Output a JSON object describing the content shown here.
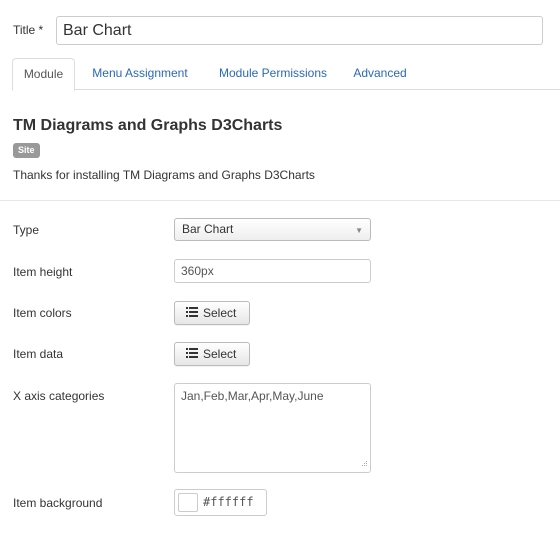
{
  "title_field": {
    "label": "Title *",
    "value": "Bar Chart"
  },
  "tabs": [
    {
      "label": "Module",
      "active": true
    },
    {
      "label": "Menu Assignment",
      "active": false
    },
    {
      "label": "Module Permissions",
      "active": false
    },
    {
      "label": "Advanced",
      "active": false
    }
  ],
  "module": {
    "name": "TM Diagrams and Graphs D3Charts",
    "badge": "Site",
    "description": "Thanks for installing TM Diagrams and Graphs D3Charts"
  },
  "form": {
    "type": {
      "label": "Type",
      "value": "Bar Chart"
    },
    "item_height": {
      "label": "Item height",
      "value": "360px"
    },
    "item_colors": {
      "label": "Item colors",
      "button": "Select"
    },
    "item_data": {
      "label": "Item data",
      "button": "Select"
    },
    "x_axis": {
      "label": "X axis categories",
      "value": "Jan,Feb,Mar,Apr,May,June"
    },
    "item_background": {
      "label": "Item background",
      "value": "#ffffff"
    }
  },
  "colors": {
    "link": "#2a69b8",
    "badge": "#999999",
    "swatch": "#ffffff"
  }
}
